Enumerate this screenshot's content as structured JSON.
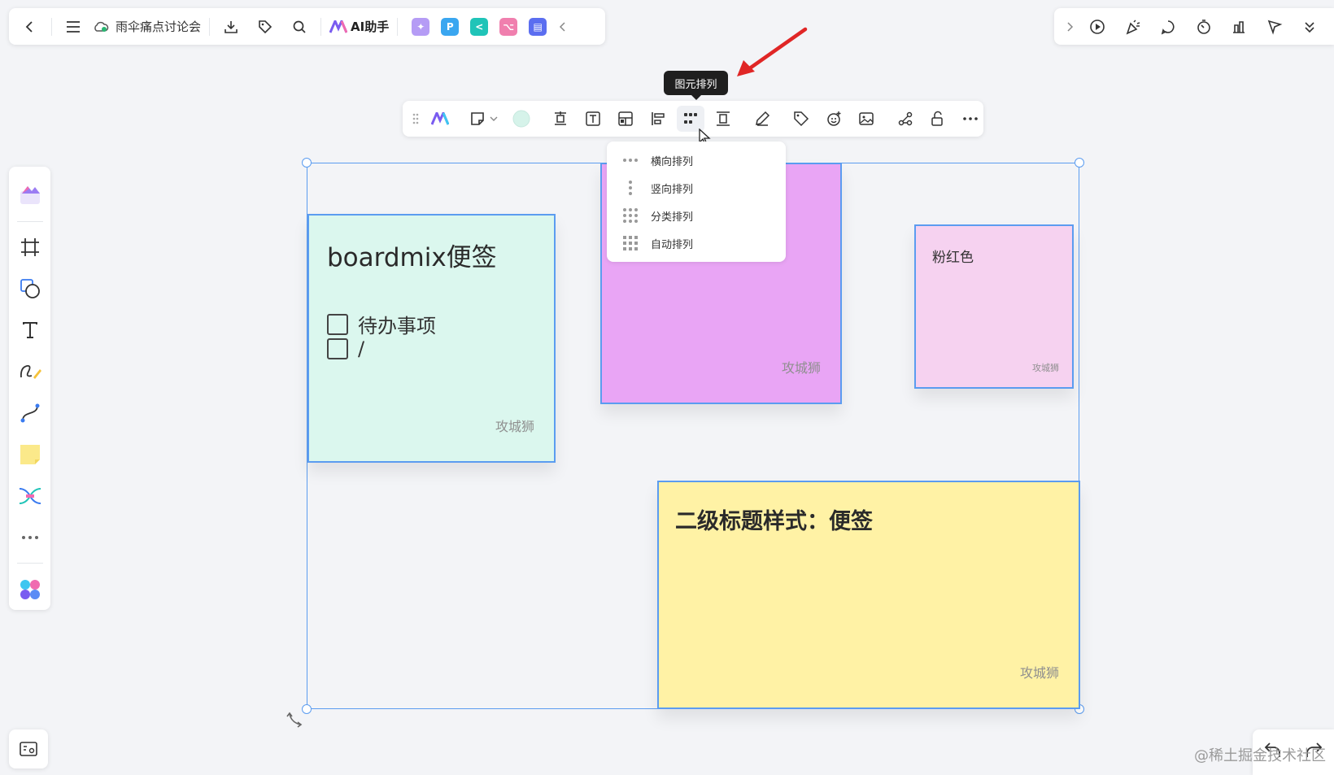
{
  "topbar": {
    "doc_title": "雨伞痛点讨论会",
    "ai_label": "AI助手",
    "app_tiles": [
      {
        "name": "image-gen-app-icon",
        "color": "#b59cf5",
        "glyph": "✦"
      },
      {
        "name": "presentation-app-icon",
        "color": "#3aa6f0",
        "glyph": "P"
      },
      {
        "name": "mindmap-app-icon",
        "color": "#20c4b8",
        "glyph": "<"
      },
      {
        "name": "flowchart-app-icon",
        "color": "#f07fae",
        "glyph": "⌥"
      },
      {
        "name": "chat-app-icon",
        "color": "#5b6ef0",
        "glyph": "▤"
      }
    ]
  },
  "tooltip": {
    "label": "图元排列"
  },
  "dropdown": {
    "items": [
      {
        "label": "横向排列"
      },
      {
        "label": "竖向排列"
      },
      {
        "label": "分类排列"
      },
      {
        "label": "自动排列"
      }
    ]
  },
  "notes": {
    "green": {
      "title": "boardmix便签",
      "todos": [
        "待办事项",
        "/"
      ],
      "author": "攻城狮"
    },
    "purple": {
      "author": "攻城狮"
    },
    "pink": {
      "title": "粉红色",
      "author": "攻城狮"
    },
    "yellow": {
      "title": "二级标题样式：便签",
      "author": "攻城狮"
    }
  },
  "colors": {
    "accent": "#5b9cf0",
    "green_note": "#dbf7ee",
    "purple_note": "#e9a5f5",
    "pink_note": "#f6d2f0",
    "yellow_note": "#fff2a5",
    "annotation_arrow": "#e02626"
  },
  "watermark": "@稀土掘金技术社区"
}
